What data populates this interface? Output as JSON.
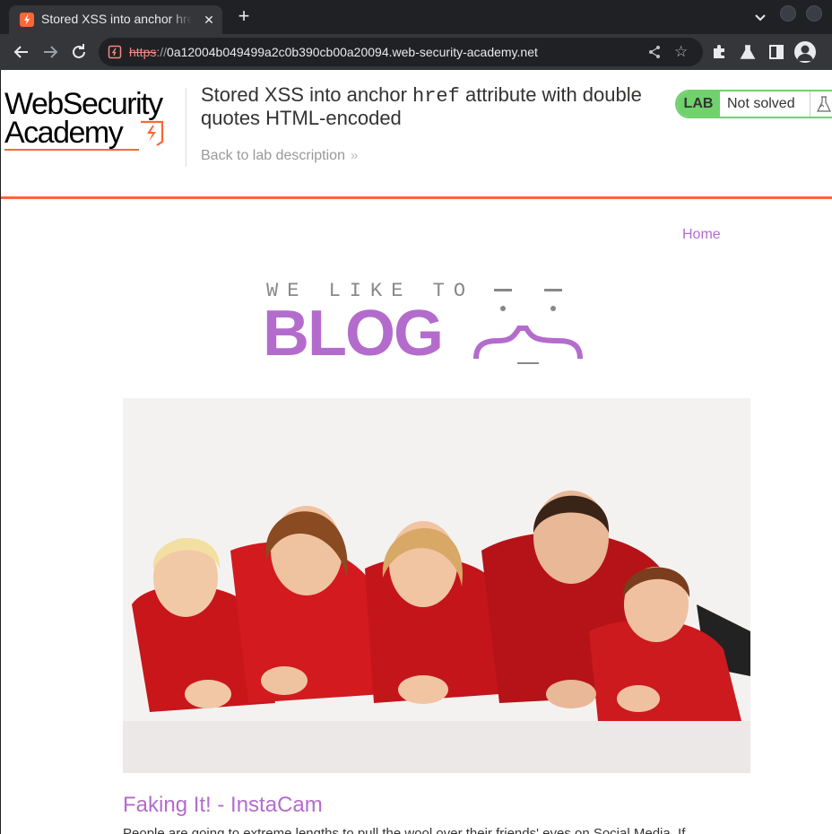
{
  "browser": {
    "tab": {
      "title": "Stored XSS into anchor href attribute with double quotes HTML-encoded",
      "close_glyph": "✕",
      "favicon": "lightning-favicon"
    },
    "new_tab_glyph": "+",
    "url": {
      "scheme": "https",
      "separator": "://",
      "host": "0a12004b049499a2c0b390cb00a20094.web-security-academy.net"
    },
    "star_glyph": "☆"
  },
  "header": {
    "logo": {
      "line1": "WebSecurity",
      "line2": "Academy"
    },
    "lab_title_before": "Stored XSS into anchor ",
    "lab_title_code": "href",
    "lab_title_after": " attribute with double quotes HTML-encoded",
    "back_link": "Back to lab description",
    "back_link_chevron": "»",
    "status": {
      "badge": "LAB",
      "state": "Not solved"
    }
  },
  "nav": {
    "home": "Home"
  },
  "banner": {
    "tagline": "WE LIKE TO",
    "word": "BLOG"
  },
  "post": {
    "title": "Faking It! - InstaCam",
    "excerpt": "People are going to extreme lengths to pull the wool over their friends' eyes on Social Media. If"
  },
  "colors": {
    "accent_orange": "#ff6633",
    "blog_purple": "#b36ccc",
    "lab_green": "#70d16d"
  }
}
